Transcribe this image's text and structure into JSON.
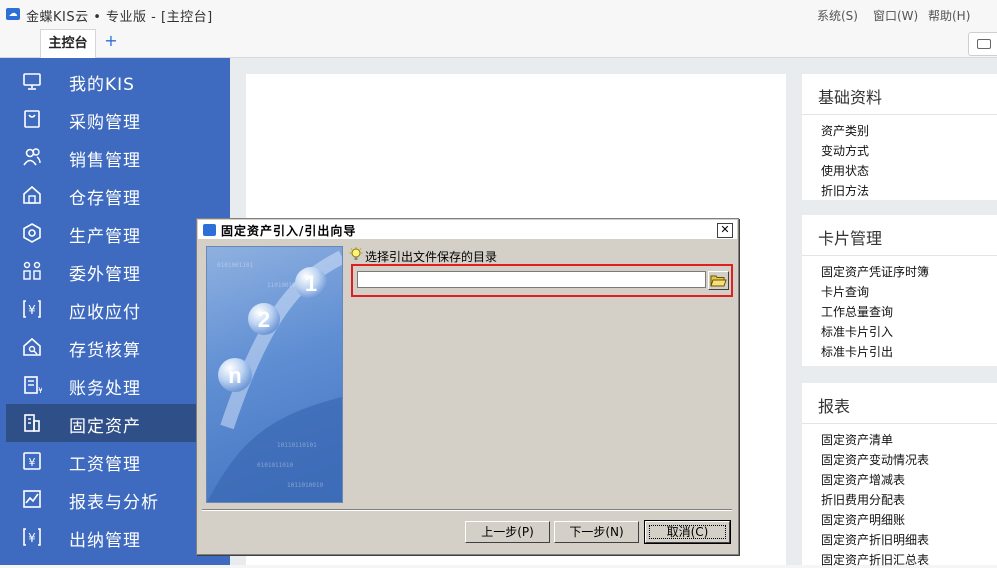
{
  "titlebar": {
    "title": "金蝶KIS云 • 专业版 - [主控台]",
    "menu": [
      "系统(S)",
      "窗口(W)",
      "帮助(H)"
    ]
  },
  "tabs": {
    "home": "主控台",
    "add": "+"
  },
  "sidebar": {
    "items": [
      {
        "label": "我的KIS",
        "icon": "monitor-icon"
      },
      {
        "label": "采购管理",
        "icon": "bag-icon"
      },
      {
        "label": "销售管理",
        "icon": "users-icon"
      },
      {
        "label": "仓存管理",
        "icon": "warehouse-icon"
      },
      {
        "label": "生产管理",
        "icon": "hexagon-gear-icon"
      },
      {
        "label": "委外管理",
        "icon": "outsource-icon"
      },
      {
        "label": "应收应付",
        "icon": "yen-bracket-icon"
      },
      {
        "label": "存货核算",
        "icon": "house-search-icon"
      },
      {
        "label": "账务处理",
        "icon": "ledger-icon"
      },
      {
        "label": "固定资产",
        "icon": "building-icon"
      },
      {
        "label": "工资管理",
        "icon": "wage-icon"
      },
      {
        "label": "报表与分析",
        "icon": "chart-icon"
      },
      {
        "label": "出纳管理",
        "icon": "cashier-icon"
      }
    ],
    "active_index": 9
  },
  "panels": [
    {
      "title": "基础资料",
      "links": [
        "资产类别",
        "变动方式",
        "使用状态",
        "折旧方法"
      ]
    },
    {
      "title": "卡片管理",
      "links": [
        "固定资产凭证序时簿",
        "卡片查询",
        "工作总量查询",
        "标准卡片引入",
        "标准卡片引出"
      ]
    },
    {
      "title": "报表",
      "links": [
        "固定资产清单",
        "固定资产变动情况表",
        "固定资产增减表",
        "折旧费用分配表",
        "固定资产明细账",
        "固定资产折旧明细表",
        "固定资产折旧汇总表"
      ]
    }
  ],
  "dialog": {
    "title": "固定资产引入/引出向导",
    "hint": "选择引出文件保存的目录",
    "path_value": "",
    "buttons": {
      "prev": "上一步(P)",
      "next": "下一步(N)",
      "cancel": "取消(C)"
    },
    "wizard_steps": [
      "1",
      "2",
      "n"
    ]
  },
  "colors": {
    "sidebar": "#3e6bbf",
    "sidebar_active": "#2f4f89",
    "highlight_border": "#e02020"
  }
}
